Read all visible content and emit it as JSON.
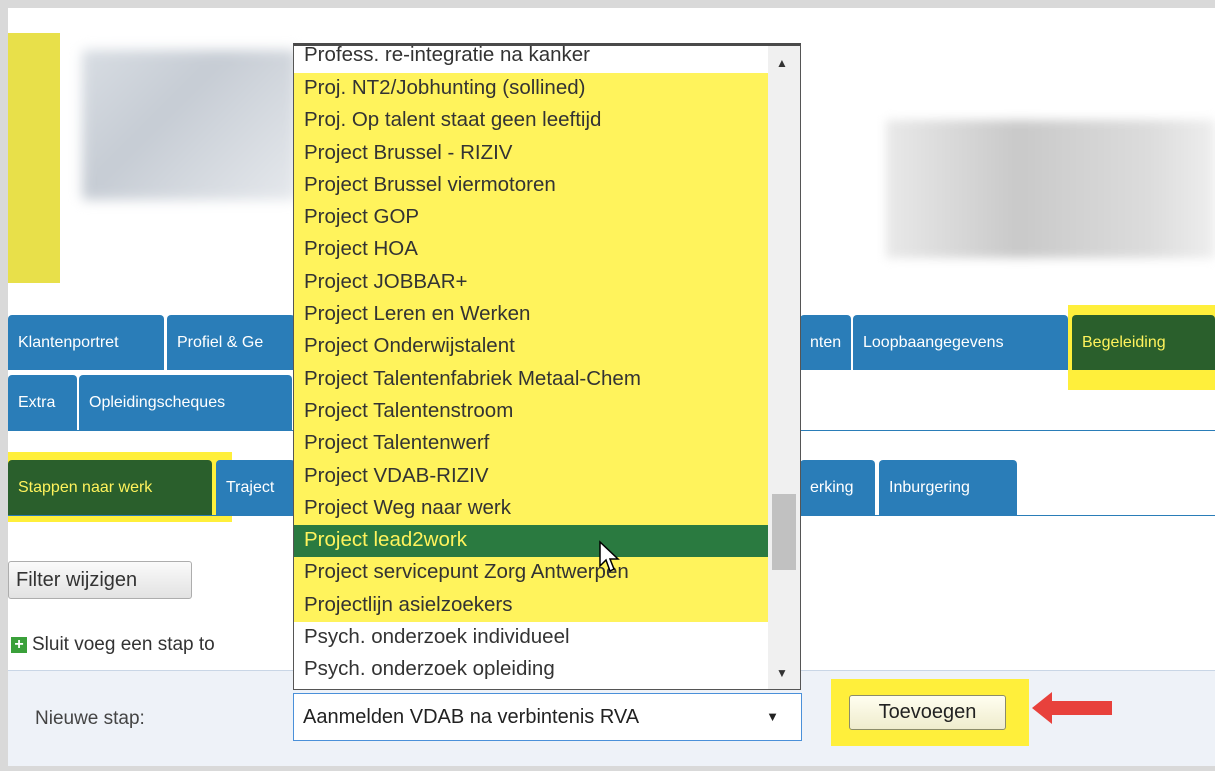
{
  "tabs_row1": [
    {
      "label": "Klantenportret"
    },
    {
      "label": "Profiel & Ge"
    },
    {
      "label": "nten"
    },
    {
      "label": "Loopbaangegevens"
    },
    {
      "label": "Begeleiding"
    }
  ],
  "tabs_row2": [
    {
      "label": "Extra"
    },
    {
      "label": "Opleidingscheques"
    }
  ],
  "subtabs": [
    {
      "label": "Stappen naar werk"
    },
    {
      "label": "Traject"
    },
    {
      "label": "erking"
    },
    {
      "label": "Inburgering"
    }
  ],
  "filter_button": "Filter wijzigen",
  "add_step_link": "Sluit voeg een stap to",
  "new_step": {
    "label": "Nieuwe stap:",
    "selected_value": "Aanmelden VDAB na verbintenis RVA",
    "add_button": "Toevoegen"
  },
  "dropdown": {
    "first_partial": "Profess. re-integratie na kanker",
    "items": [
      {
        "label": "Proj. NT2/Jobhunting (sollined)",
        "state": "highlight"
      },
      {
        "label": "Proj. Op talent staat geen leeftijd",
        "state": "highlight"
      },
      {
        "label": "Project Brussel - RIZIV",
        "state": "highlight"
      },
      {
        "label": "Project Brussel viermotoren",
        "state": "highlight"
      },
      {
        "label": "Project GOP",
        "state": "highlight"
      },
      {
        "label": "Project HOA",
        "state": "highlight"
      },
      {
        "label": "Project JOBBAR+",
        "state": "highlight"
      },
      {
        "label": "Project Leren en Werken",
        "state": "highlight"
      },
      {
        "label": "Project Onderwijstalent",
        "state": "highlight"
      },
      {
        "label": "Project Talentenfabriek Metaal-Chem",
        "state": "highlight"
      },
      {
        "label": "Project Talentenstroom",
        "state": "highlight"
      },
      {
        "label": "Project Talentenwerf",
        "state": "highlight"
      },
      {
        "label": "Project VDAB-RIZIV",
        "state": "highlight"
      },
      {
        "label": "Project Weg naar werk",
        "state": "highlight"
      },
      {
        "label": "Project lead2work",
        "state": "selected"
      },
      {
        "label": "Project servicepunt Zorg Antwerpen",
        "state": "highlight"
      },
      {
        "label": "Projectlijn asielzoekers",
        "state": "highlight"
      },
      {
        "label": "Psych. onderzoek individueel",
        "state": "normal"
      },
      {
        "label": "Psych. onderzoek opleiding",
        "state": "normal"
      },
      {
        "label": "",
        "state": "normal"
      }
    ]
  },
  "colors": {
    "tab_blue": "#2a7db8",
    "tab_active": "#2a5f2c",
    "highlight_yellow": "#ffef3b",
    "selected_green": "#2a7a40",
    "arrow_red": "#e8413c"
  }
}
